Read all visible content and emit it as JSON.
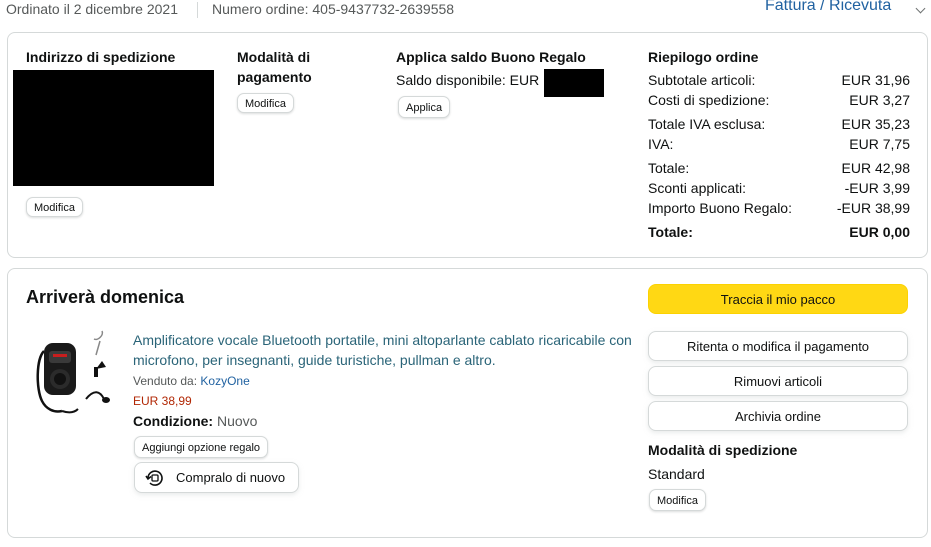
{
  "header": {
    "ordered_on": "Ordinato il 2 dicembre 2021",
    "order_number": "Numero ordine: 405-9437732-2639558",
    "invoice_link": "Fattura / Ricevuta"
  },
  "summary_card": {
    "shipping_address": {
      "title": "Indirizzo di spedizione",
      "edit_label": "Modifica"
    },
    "payment": {
      "title_line1": "Modalità di",
      "title_line2": "pagamento",
      "edit_label": "Modifica"
    },
    "gift_card": {
      "title": "Applica saldo Buono Regalo",
      "balance_label": "Saldo disponibile: EUR",
      "apply_label": "Applica"
    },
    "order_summary": {
      "title": "Riepilogo ordine",
      "rows": [
        {
          "label": "Subtotale articoli:",
          "value": "EUR 31,96"
        },
        {
          "label": "Costi di spedizione:",
          "value": "EUR 3,27"
        },
        {
          "label": "Totale IVA esclusa:",
          "value": "EUR 35,23"
        },
        {
          "label": "IVA:",
          "value": "EUR 7,75"
        },
        {
          "label": "Totale:",
          "value": "EUR 42,98"
        },
        {
          "label": "Sconti applicati:",
          "value": "-EUR 3,99"
        },
        {
          "label": "Importo Buono Regalo:",
          "value": "-EUR 38,99"
        },
        {
          "label": "Totale:",
          "value": "EUR 0,00"
        }
      ]
    }
  },
  "shipment_card": {
    "delivery_status": "Arriverà domenica",
    "product": {
      "title": "Amplificatore vocale Bluetooth portatile, mini altoparlante cablato ricaricabile con microfono, per insegnanti, guide turistiche, pullman e altro.",
      "sold_by_label": "Venduto da:",
      "seller": "KozyOne",
      "price": "EUR 38,99",
      "condition_label": "Condizione:",
      "condition_value": "Nuovo",
      "gift_option_label": "Aggiungi opzione regalo",
      "buy_again_label": "Compralo di nuovo"
    },
    "actions": {
      "track": "Traccia il mio pacco",
      "retry_payment": "Ritenta o modifica il pagamento",
      "remove_items": "Rimuovi articoli",
      "archive_order": "Archivia ordine"
    },
    "shipping_method": {
      "title": "Modalità di spedizione",
      "value": "Standard",
      "edit_label": "Modifica"
    }
  },
  "colors": {
    "link": "#2162a1",
    "product_link": "#2a6478",
    "price": "#b12704",
    "primary_button": "#ffd814",
    "border": "#d5d9d9"
  }
}
